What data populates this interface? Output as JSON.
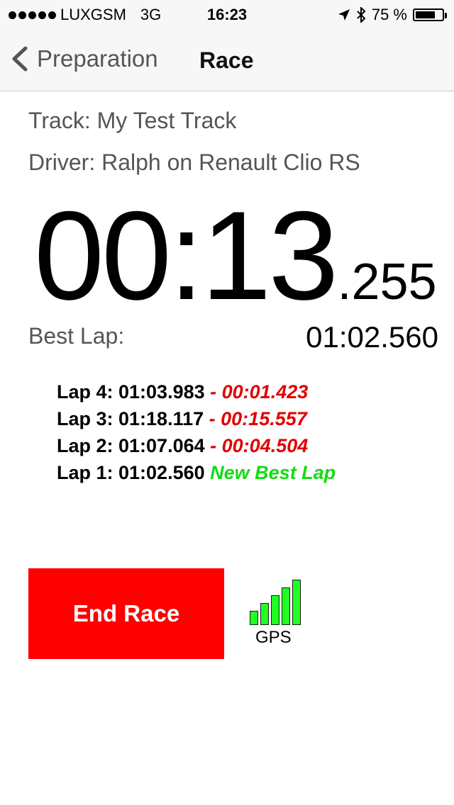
{
  "status_bar": {
    "carrier": "LUXGSM",
    "network": "3G",
    "time": "16:23",
    "battery_percent": "75 %",
    "battery_level": 0.75
  },
  "nav": {
    "back_label": "Preparation",
    "title": "Race"
  },
  "race": {
    "track": "Track: My Test Track",
    "driver": "Driver: Ralph on Renault Clio RS",
    "timer_main": "00:13",
    "timer_ms": ".255",
    "best_lap_label": "Best Lap:",
    "best_lap_value": "01:02.560"
  },
  "laps": [
    {
      "label": "Lap 4: 01:03.983",
      "delta": "- 00:01.423",
      "type": "diff"
    },
    {
      "label": "Lap 3: 01:18.117",
      "delta": "- 00:15.557",
      "type": "diff"
    },
    {
      "label": "Lap 2: 01:07.064",
      "delta": "- 00:04.504",
      "type": "diff"
    },
    {
      "label": "Lap 1: 01:02.560",
      "delta": "New Best Lap",
      "type": "best"
    }
  ],
  "actions": {
    "end_race_label": "End Race"
  },
  "gps": {
    "label": "GPS",
    "signal_bars": 5
  },
  "colors": {
    "delta": "#e00000",
    "best": "#11dd11",
    "end_race": "#ff0000",
    "gps_bar": "#22ff22"
  }
}
